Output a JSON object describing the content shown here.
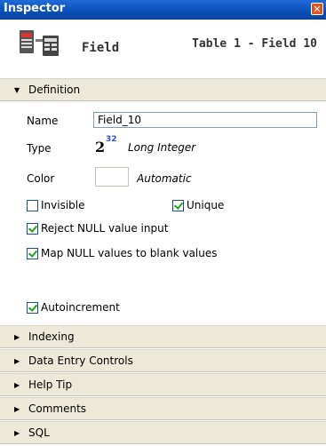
{
  "window": {
    "title": "Inspector",
    "close_glyph": "✕"
  },
  "header": {
    "kind": "Field",
    "reference": "Table 1 - Field 10",
    "icon": "field-table-icon"
  },
  "definition": {
    "section_label": "Definition",
    "name_label": "Name",
    "name_value": "Field_10",
    "type_label": "Type",
    "type_value": "Long Integer",
    "type_icon": {
      "base": "2",
      "exponent": "32"
    },
    "color_label": "Color",
    "color_value": "Automatic",
    "checkboxes": {
      "invisible": {
        "label": "Invisible",
        "checked": false
      },
      "unique": {
        "label": "Unique",
        "checked": true
      },
      "reject_null": {
        "label": "Reject NULL value input",
        "checked": true
      },
      "map_null": {
        "label": "Map NULL values to blank values",
        "checked": true
      },
      "autoincrement": {
        "label": "Autoincrement",
        "checked": true
      }
    }
  },
  "sections": {
    "indexing": "Indexing",
    "data_entry": "Data Entry Controls",
    "help_tip": "Help Tip",
    "comments": "Comments",
    "sql": "SQL"
  },
  "colors": {
    "titlebar": "#0b4fb8",
    "section_bg": "#ece9d8",
    "check": "#21a121",
    "close": "#e0541f"
  }
}
